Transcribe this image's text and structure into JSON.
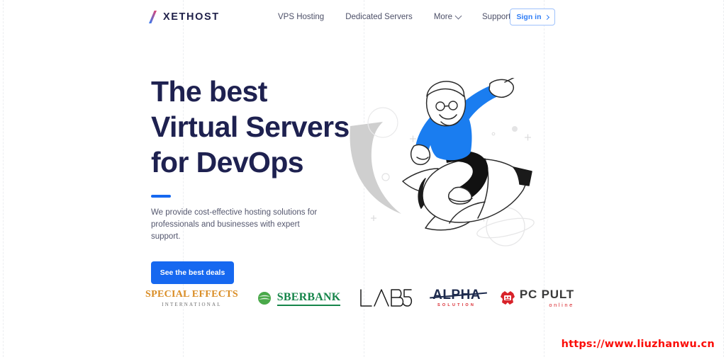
{
  "site": {
    "background_color": "#ffffff",
    "accent_color": "#1668f0",
    "heading_color": "#1e2150"
  },
  "header": {
    "logo": {
      "mark_name": "slash-logo-icon",
      "mark_gradient_from": "#e8436f",
      "mark_gradient_to": "#2f7df6",
      "text": "XETHOST"
    },
    "nav": [
      {
        "label": "VPS Hosting",
        "has_dropdown": false
      },
      {
        "label": "Dedicated Servers",
        "has_dropdown": false
      },
      {
        "label": "More",
        "has_dropdown": true
      },
      {
        "label": "Support",
        "has_dropdown": true
      }
    ],
    "signin": {
      "label": "Sign in",
      "arrow": "chevron-right-icon",
      "border_color": "#9fc2fb",
      "text_color": "#2f7df6"
    }
  },
  "hero": {
    "title_lines": [
      "The best",
      "Virtual Servers",
      "for DevOps"
    ],
    "accent_bar_color": "#1668f0",
    "subtitle_lines": [
      "We provide cost-effective hosting solutions for",
      "professionals and businesses with expert support."
    ],
    "cta": {
      "label": "See the best deals",
      "background": "#1668f0",
      "text_color": "#ffffff"
    },
    "illustration": {
      "name": "astronaut-riding-rocket-illustration",
      "shirt_color": "#1a7df0",
      "pants_color": "#111111",
      "trail_color": "#c9c9c9",
      "elements": [
        "rocket",
        "person-pointing",
        "planet-with-ring",
        "circles",
        "plus-sparkles"
      ]
    }
  },
  "partners": [
    {
      "name": "special-effects-international",
      "main": "SPECIAL EFFECTS",
      "sub": "INTERNATIONAL",
      "color": "#d98c24"
    },
    {
      "name": "sberbank",
      "main": "SBERBANK",
      "sub": "",
      "color": "#16854a"
    },
    {
      "name": "lab5",
      "main": "LAB5",
      "sub": "",
      "color": "#1a1a1a"
    },
    {
      "name": "alpha-solution",
      "main": "ALPHA",
      "sub": "SOLUTION",
      "color": "#1d2a4d"
    },
    {
      "name": "pc-pult-online",
      "main": "PC PULT",
      "sub": "online",
      "color": "#3a3a3a"
    }
  ],
  "watermark": {
    "text": "https://www.liuzhanwu.cn",
    "color": "#fb0d08"
  },
  "decor": {
    "grid_line_positions": [
      4,
      258,
      513,
      767,
      1020
    ],
    "grid_line_color": "#eceef1"
  }
}
